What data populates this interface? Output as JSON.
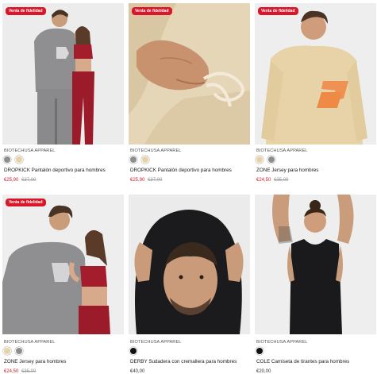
{
  "products": [
    {
      "badge": "Venta de fidelidad",
      "brand": "BIOTECHUSA APPAREL",
      "swatches": [
        "#8e8e8e",
        "#e4d4a8"
      ],
      "title": "DROPKICK Pantalón deportivo para hombres",
      "price": "€25,90",
      "old_price": "€37,00"
    },
    {
      "badge": "Venta de fidelidad",
      "brand": "BIOTECHUSA APPAREL",
      "swatches": [
        "#8e8e8e",
        "#e4d4a8"
      ],
      "title": "DROPKICK Pantalón deportivo para hombres",
      "price": "€25,90",
      "old_price": "€37,00"
    },
    {
      "badge": "Venta de fidelidad",
      "brand": "BIOTECHUSA APPAREL",
      "swatches": [
        "#e4d4a8",
        "#8e8e8e"
      ],
      "title": "ZONE Jersey para hombres",
      "price": "€24,50",
      "old_price": "€35,00"
    },
    {
      "badge": "Venta de fidelidad",
      "brand": "BIOTECHUSA APPAREL",
      "swatches": [
        "#e4d4a8",
        "#8e8e8e"
      ],
      "title": "ZONE Jersey para hombres",
      "price": "€24,50",
      "old_price": "€35,00"
    },
    {
      "badge": "",
      "brand": "BIOTECHUSA APPAREL",
      "swatches": [
        "#111111"
      ],
      "title": "DERBY Sudadera con cremallera para hombres",
      "price": "€40,00",
      "old_price": ""
    },
    {
      "badge": "",
      "brand": "BIOTECHUSA APPAREL",
      "swatches": [
        "#111111"
      ],
      "title": "COLE Camiseta de tirantes para hombres",
      "price": "€20,00",
      "old_price": ""
    }
  ],
  "colors": {
    "sale_red": "#d21b2e",
    "badge_red": "#d8172b",
    "text": "#1a1a1a",
    "muted": "#999999"
  }
}
